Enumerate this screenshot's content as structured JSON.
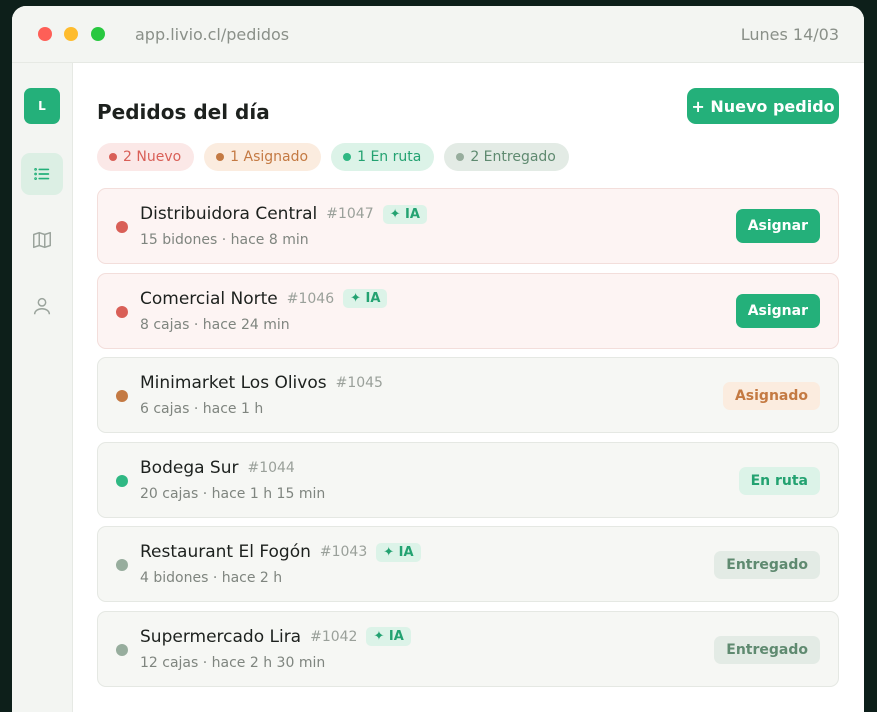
{
  "window": {
    "url": "app.livio.cl/pedidos",
    "date": "Lunes 14/03"
  },
  "sidebar": {
    "logo": "L",
    "items": [
      {
        "icon": "list-icon",
        "active": true
      },
      {
        "icon": "map-icon",
        "active": false
      },
      {
        "icon": "user-icon",
        "active": false
      }
    ]
  },
  "header": {
    "title": "Pedidos del día",
    "new_button": "+ Nuevo pedido"
  },
  "filters": [
    {
      "label": "2 Nuevo",
      "status": "new"
    },
    {
      "label": "1 Asignado",
      "status": "assigned"
    },
    {
      "label": "1 En ruta",
      "status": "route"
    },
    {
      "label": "2 Entregado",
      "status": "delivered"
    }
  ],
  "ia_label": "✦ IA",
  "orders": [
    {
      "name": "Distribuidora Central",
      "number": "#1047",
      "ia": true,
      "meta": "15 bidones · hace 8 min",
      "status": "new",
      "action": "Asignar"
    },
    {
      "name": "Comercial Norte",
      "number": "#1046",
      "ia": true,
      "meta": "8 cajas · hace 24 min",
      "status": "new",
      "action": "Asignar"
    },
    {
      "name": "Minimarket Los Olivos",
      "number": "#1045",
      "ia": false,
      "meta": "6 cajas · hace 1 h",
      "status": "assigned",
      "action": "Asignado"
    },
    {
      "name": "Bodega Sur",
      "number": "#1044",
      "ia": false,
      "meta": "20 cajas · hace 1 h 15 min",
      "status": "route",
      "action": "En ruta"
    },
    {
      "name": "Restaurant El Fogón",
      "number": "#1043",
      "ia": true,
      "meta": "4 bidones · hace 2 h",
      "status": "delivered",
      "action": "Entregado"
    },
    {
      "name": "Supermercado Lira",
      "number": "#1042",
      "ia": true,
      "meta": "12 cajas · hace 2 h 30 min",
      "status": "delivered",
      "action": "Entregado"
    }
  ],
  "colors": {
    "accent": "#24b07a",
    "new": "#d95f57",
    "assigned": "#c47a43",
    "route": "#2fb883",
    "delivered": "#97ad9d"
  }
}
